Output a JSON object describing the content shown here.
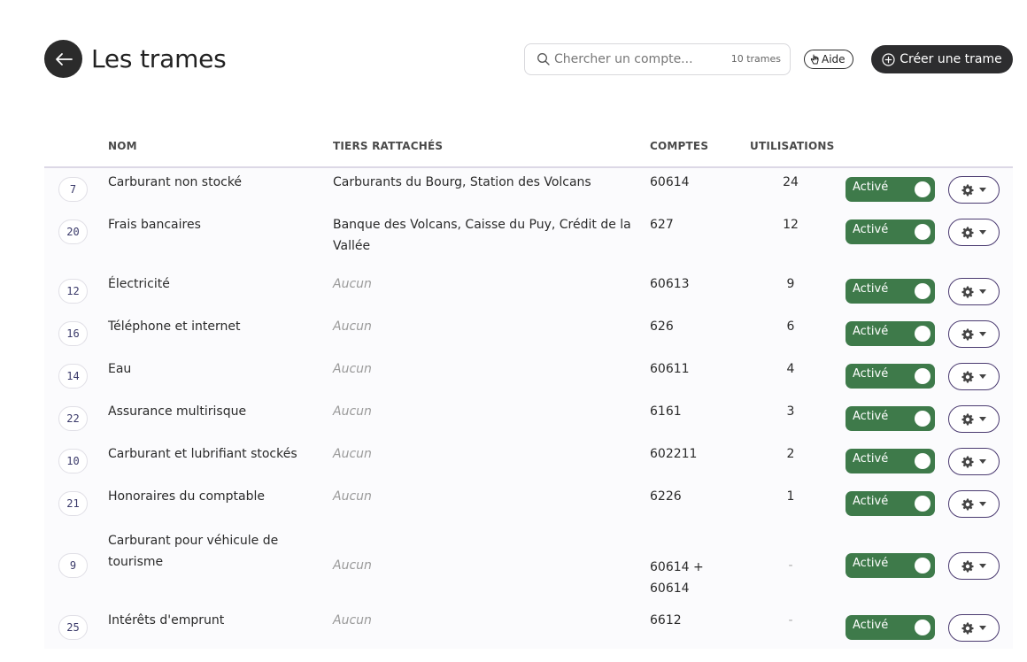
{
  "header": {
    "title": "Les trames",
    "search_placeholder": "Chercher un compte...",
    "count": "10 trames",
    "help_label": "Aide",
    "create_label": "Créer une trame"
  },
  "columns": {
    "name": "NOM",
    "tiers": "TIERS RATTACHÉS",
    "accounts": "COMPTES",
    "usages": "UTILISATIONS"
  },
  "rows": [
    {
      "id": "7",
      "name_lines": [
        "Carburant non stocké"
      ],
      "tiers_lines": [
        "Carburants du Bourg, Station des Volcans"
      ],
      "tiers_none": false,
      "account_lines": [
        "60614"
      ],
      "uses": "24",
      "status": "Activé"
    },
    {
      "id": "20",
      "name_lines": [
        "Frais bancaires"
      ],
      "tiers_lines": [
        "Banque des Volcans, Caisse du Puy, Crédit de la",
        "Vallée"
      ],
      "tiers_none": false,
      "account_lines": [
        "627"
      ],
      "uses": "12",
      "status": "Activé"
    },
    {
      "id": "12",
      "name_lines": [
        "Électricité"
      ],
      "tiers_lines": [
        "Aucun"
      ],
      "tiers_none": true,
      "account_lines": [
        "60613"
      ],
      "uses": "9",
      "status": "Activé"
    },
    {
      "id": "16",
      "name_lines": [
        "Téléphone et internet"
      ],
      "tiers_lines": [
        "Aucun"
      ],
      "tiers_none": true,
      "account_lines": [
        "626"
      ],
      "uses": "6",
      "status": "Activé"
    },
    {
      "id": "14",
      "name_lines": [
        "Eau"
      ],
      "tiers_lines": [
        "Aucun"
      ],
      "tiers_none": true,
      "account_lines": [
        "60611"
      ],
      "uses": "4",
      "status": "Activé"
    },
    {
      "id": "22",
      "name_lines": [
        "Assurance multirisque"
      ],
      "tiers_lines": [
        "Aucun"
      ],
      "tiers_none": true,
      "account_lines": [
        "6161"
      ],
      "uses": "3",
      "status": "Activé"
    },
    {
      "id": "10",
      "name_lines": [
        "Carburant et lubrifiant stockés"
      ],
      "tiers_lines": [
        "Aucun"
      ],
      "tiers_none": true,
      "account_lines": [
        "602211"
      ],
      "uses": "2",
      "status": "Activé"
    },
    {
      "id": "21",
      "name_lines": [
        "Honoraires du comptable"
      ],
      "tiers_lines": [
        "Aucun"
      ],
      "tiers_none": true,
      "account_lines": [
        "6226"
      ],
      "uses": "1",
      "status": "Activé"
    },
    {
      "id": "9",
      "name_lines": [
        "Carburant pour véhicule de",
        "tourisme"
      ],
      "tiers_lines": [
        "Aucun"
      ],
      "tiers_none": true,
      "account_lines": [
        "60614 +",
        "60614"
      ],
      "uses": "-",
      "status": "Activé"
    },
    {
      "id": "25",
      "name_lines": [
        "Intérêts d'emprunt"
      ],
      "tiers_lines": [
        "Aucun"
      ],
      "tiers_none": true,
      "account_lines": [
        "6612"
      ],
      "uses": "-",
      "status": "Activé"
    }
  ],
  "icons": {
    "back": "arrow-left-icon",
    "search": "search-icon",
    "help": "hand-pointer-icon",
    "create": "plus-circle-icon",
    "gear": "gear-icon",
    "caret": "caret-down-icon"
  },
  "colors": {
    "toggle_active": "#3e7a4a",
    "gear_border": "#4a3a70",
    "primary_dark": "#2d2d2f"
  }
}
